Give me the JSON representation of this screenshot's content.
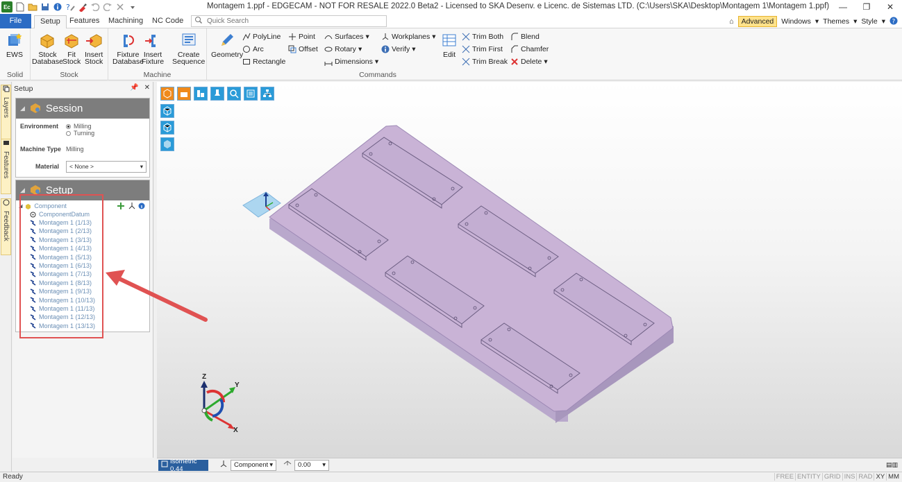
{
  "window": {
    "title": "Montagem 1.ppf - EDGECAM - NOT FOR RESALE 2022.0  Beta2 - Licensed to SKA Desenv. e Licenc. de Sistemas LTD. (C:\\Users\\SKA\\Desktop\\Montagem 1\\Montagem 1.ppf)",
    "app_logo": "Ec"
  },
  "tabs": {
    "file": "File",
    "items": [
      "Setup",
      "Features",
      "Machining",
      "NC Code"
    ],
    "quick_search_placeholder": "Quick Search"
  },
  "rightnav": {
    "advanced": "Advanced",
    "windows": "Windows",
    "themes": "Themes",
    "style": "Style"
  },
  "ribbon": {
    "solid": {
      "label": "Solid",
      "ews": "EWS"
    },
    "stock": {
      "label": "Stock",
      "stock_database": [
        "Stock",
        "Database"
      ],
      "fit_stock": [
        "Fit",
        "Stock"
      ],
      "insert_stock": [
        "Insert",
        "Stock"
      ]
    },
    "machine": {
      "label": "Machine",
      "fixture_database": [
        "Fixture",
        "Database"
      ],
      "insert_fixture": [
        "Insert",
        "Fixture"
      ],
      "create_sequence": [
        "Create",
        "Sequence"
      ]
    },
    "commands": {
      "label": "Commands",
      "geometry": "Geometry",
      "polyline": "PolyLine",
      "arc": "Arc",
      "rectangle": "Rectangle",
      "point": "Point",
      "offset": "Offset",
      "surfaces": "Surfaces",
      "rotary": "Rotary",
      "dimensions": "Dimensions",
      "workplanes": "Workplanes",
      "verify": "Verify",
      "edit": "Edit",
      "trim_both": "Trim Both",
      "trim_first": "Trim First",
      "trim_break": "Trim Break",
      "blend": "Blend",
      "chamfer": "Chamfer",
      "delete": "Delete"
    }
  },
  "leftstrip": {
    "layers": "Layers",
    "features": "Features",
    "feedback": "Feedback"
  },
  "panel": {
    "title": "Setup",
    "session": {
      "title": "Session",
      "environment_label": "Environment",
      "environment_options": [
        "Milling",
        "Turning"
      ],
      "environment_selected": "Milling",
      "machine_type_label": "Machine Type",
      "machine_type_value": "Milling",
      "material_label": "Material",
      "material_value": "< None >"
    },
    "setup": {
      "title": "Setup",
      "root": "Component",
      "datum": "ComponentDatum",
      "items": [
        "Montagem 1 (1/13)",
        "Montagem 1 (2/13)",
        "Montagem 1 (3/13)",
        "Montagem 1 (4/13)",
        "Montagem 1 (5/13)",
        "Montagem 1 (6/13)",
        "Montagem 1 (7/13)",
        "Montagem 1 (8/13)",
        "Montagem 1 (9/13)",
        "Montagem 1 (10/13)",
        "Montagem 1 (11/13)",
        "Montagem 1 (12/13)",
        "Montagem 1 (13/13)"
      ]
    }
  },
  "viewport": {
    "axes": {
      "x": "X",
      "y": "Y",
      "z": "Z"
    }
  },
  "viewbar": {
    "view": "Isometric 0.44",
    "component": "Component",
    "angle": "0.00"
  },
  "status": {
    "text": "Ready",
    "flags": [
      "FREE",
      "ENTITY",
      "GRID",
      "INS",
      "RAD",
      "XY",
      "MM"
    ],
    "active_flags": [
      "XY",
      "MM"
    ]
  },
  "colors": {
    "accent": "#2b6cc4",
    "part_top": "#c9b3d6",
    "annotation": "#e05252"
  }
}
